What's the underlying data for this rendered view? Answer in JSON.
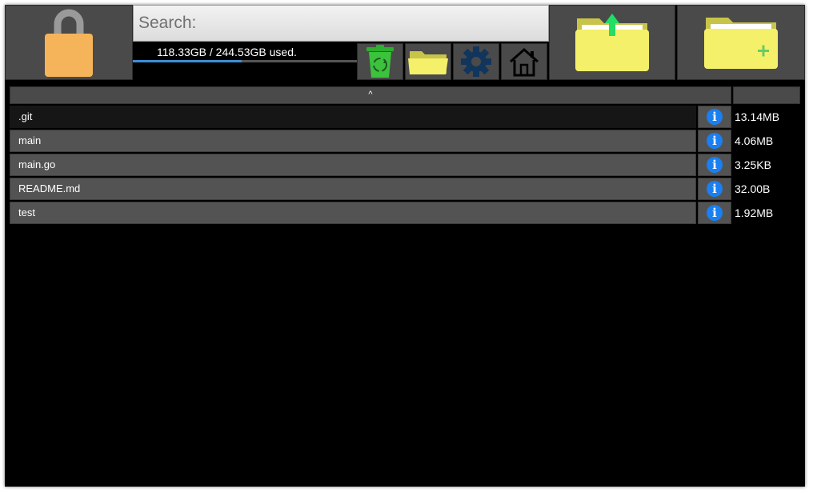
{
  "search": {
    "placeholder": "Search:"
  },
  "storage": {
    "usage_text": "118.33GB / 244.53GB used.",
    "used_fraction": 0.484
  },
  "toolbar": {
    "icons": [
      "lock-icon",
      "trash-icon",
      "open-folder-icon",
      "gear-icon",
      "home-icon",
      "upload-folder-icon",
      "new-folder-icon"
    ]
  },
  "list": {
    "sort_indicator": "^",
    "files": [
      {
        "name": ".git",
        "size": "13.14MB",
        "selected": true
      },
      {
        "name": "main",
        "size": "4.06MB",
        "selected": false
      },
      {
        "name": "main.go",
        "size": "3.25KB",
        "selected": false
      },
      {
        "name": "README.md",
        "size": "32.00B",
        "selected": false
      },
      {
        "name": "test",
        "size": "1.92MB",
        "selected": false
      }
    ]
  },
  "colors": {
    "background": "#000000",
    "tile": "#4a4a4a",
    "row": "#535353",
    "row_selected": "#161616",
    "lock": "#f5b45a",
    "folder": "#f5f06a",
    "recycle": "#3cc23c",
    "gear": "#12355c",
    "info": "#1a7ff0",
    "upload_arrow": "#22dd66",
    "plus": "#66cc66",
    "usage_fill": "#3a8fd6"
  }
}
